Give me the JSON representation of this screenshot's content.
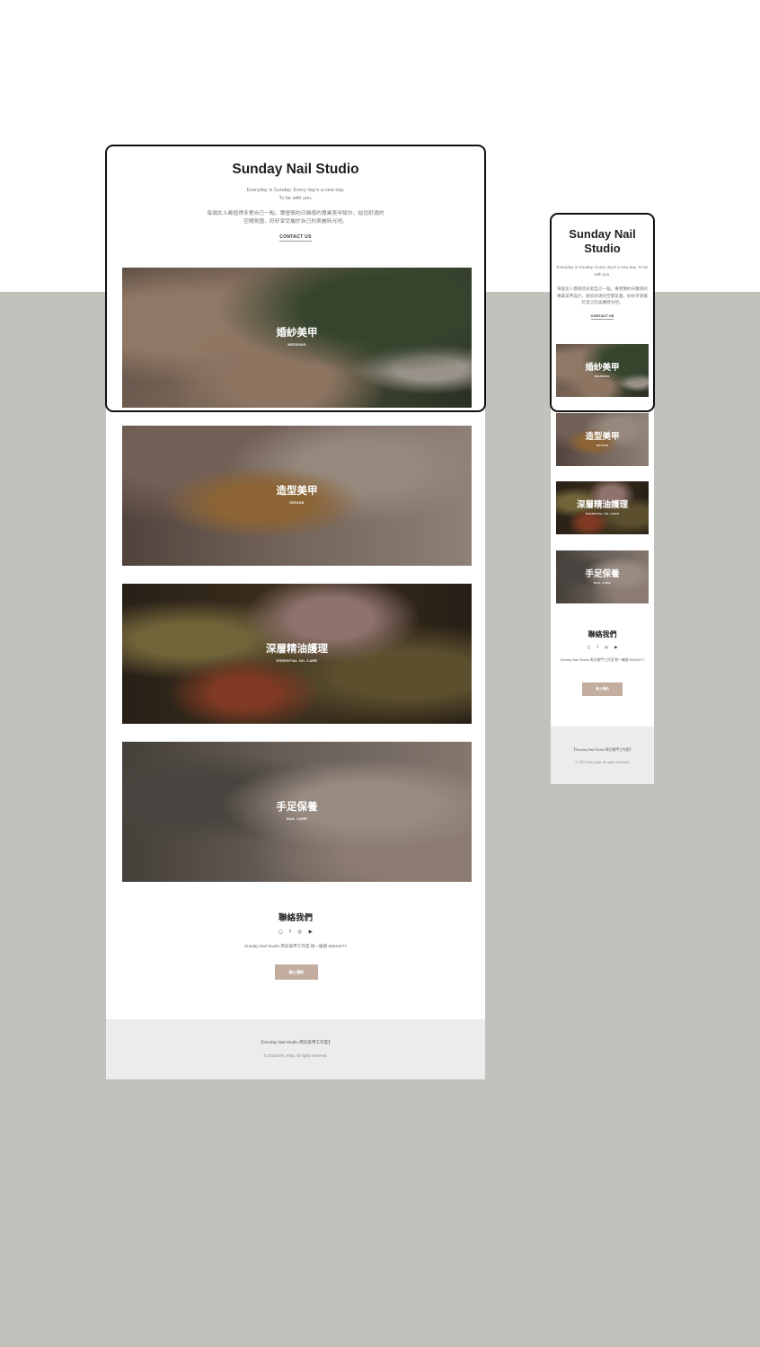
{
  "site": {
    "title": "Sunday Nail Studio",
    "tagline_line1": "Everyday is Sunday. Every day's a new day.",
    "tagline_line2": "To be with you.",
    "tagline_full": "Everyday is Sunday. Every day's a new day. To be with you.",
    "intro": "每個女人都值得多愛自己一點。專營簡約日雜感的專業美甲設計，給您舒適的空間氛圍，好好享受屬於自己的美麗時光吧。",
    "contact_link": "CONTACT US"
  },
  "services": [
    {
      "zh": "婚紗美甲",
      "en": "WEDDING"
    },
    {
      "zh": "造型美甲",
      "en": "DESIGN"
    },
    {
      "zh": "深層精油護理",
      "en": "ESSENTIAL OIL CARE"
    },
    {
      "zh": "手足保養",
      "en": "NAIL CARE"
    }
  ],
  "contact": {
    "title": "聯絡我們",
    "icons": [
      "line-icon",
      "facebook-icon",
      "instagram-icon",
      "youtube-icon"
    ],
    "info": "Sunday Nail Studio 周日美甲工作室 統一編號 89044277",
    "button": "線上預約"
  },
  "footer": {
    "line1": "【Sunday Nail Studio 周日美甲工作室】",
    "line2": "© 2023 Mini_shop. All rights reserved."
  },
  "colors": {
    "background_gray": "#c0c3bb",
    "button": "#c2ad9f",
    "footer": "#ececec"
  }
}
